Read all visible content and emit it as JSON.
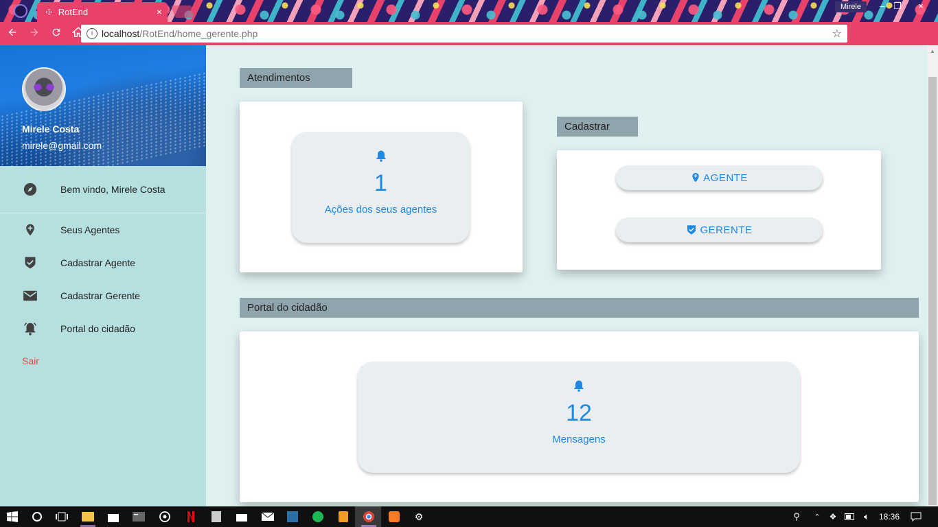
{
  "browser": {
    "tab_title": "RotEnd",
    "tab_close": "×",
    "profile_name": "Mirele",
    "url_host": "localhost",
    "url_path": "/RotEnd/home_gerente.php",
    "win_minimize": "–",
    "win_restore": "❐",
    "win_close": "×"
  },
  "sidebar": {
    "user_name": "Mirele Costa",
    "user_email": "mirele@gmail.com",
    "items": [
      {
        "label": "Bem vindo, Mirele Costa",
        "icon": "compass-icon"
      },
      {
        "label": "Seus Agentes",
        "icon": "pin-plus-icon"
      },
      {
        "label": "Cadastrar Agente",
        "icon": "shield-check-icon"
      },
      {
        "label": "Cadastrar Gerente",
        "icon": "mail-icon"
      },
      {
        "label": "Portal do cidadão",
        "icon": "bell-ring-icon"
      }
    ],
    "logout_label": "Sair"
  },
  "main": {
    "atendimentos": {
      "title": "Atendimentos",
      "count": "1",
      "label": "Ações dos seus agentes"
    },
    "cadastrar": {
      "title": "Cadastrar",
      "agente_label": "AGENTE",
      "gerente_label": "GERENTE"
    },
    "portal": {
      "title": "Portal do cidadão",
      "count": "12",
      "label": "Mensagens"
    }
  },
  "taskbar": {
    "time": "18:36"
  },
  "colors": {
    "accent": "#1e88e5",
    "sidebar_bg": "#b6e0e0",
    "section_header": "#90a4ae",
    "logout": "#f4433a",
    "browser_bar": "#e8416a"
  }
}
